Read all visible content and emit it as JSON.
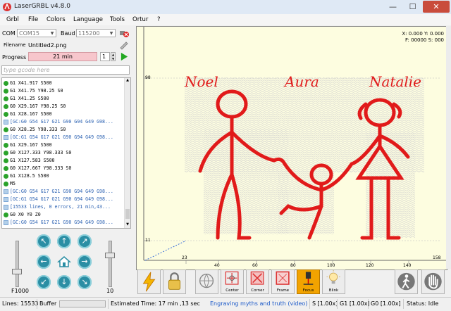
{
  "window": {
    "title": "LaserGRBL v4.8.0",
    "minimize": "—",
    "maximize": "☐",
    "close": "✕"
  },
  "menu": [
    "Grbl",
    "File",
    "Colors",
    "Language",
    "Tools",
    "Ortur",
    "?"
  ],
  "connection": {
    "com_label": "COM",
    "com_value": "COM15",
    "baud_label": "Baud",
    "baud_value": "115200"
  },
  "file": {
    "label": "Filename",
    "value": "Untitled2.png"
  },
  "progress": {
    "label": "Progress",
    "value_text": "21 min",
    "copies": "1"
  },
  "command": {
    "placeholder": "type gcode here"
  },
  "console": [
    {
      "kind": "ok",
      "text": "G1 X41.917 S500"
    },
    {
      "kind": "ok",
      "text": "G1 X41.75 Y98.25 S0"
    },
    {
      "kind": "ok",
      "text": "G1 X41.25 S500"
    },
    {
      "kind": "ok",
      "text": "G0 X29.167 Y98.25 S0"
    },
    {
      "kind": "ok",
      "text": "G1 X28.167 S500"
    },
    {
      "kind": "info",
      "text": "[GC:G0 G54 G17 G21 G90 G94 G49 G98..."
    },
    {
      "kind": "ok",
      "text": "G0 X28.25 Y98.333 S0"
    },
    {
      "kind": "info",
      "text": "[GC:G1 G54 G17 G21 G90 G94 G49 G98..."
    },
    {
      "kind": "ok",
      "text": "G1 X29.167 S500"
    },
    {
      "kind": "ok",
      "text": "G0 X127.333 Y98.333 S0"
    },
    {
      "kind": "ok",
      "text": "G1 X127.583 S500"
    },
    {
      "kind": "ok",
      "text": "G0 X127.667 Y98.333 S0"
    },
    {
      "kind": "ok",
      "text": "G1 X128.5 S500"
    },
    {
      "kind": "ok",
      "text": "M5"
    },
    {
      "kind": "info",
      "text": "[GC:G0 G54 G17 G21 G90 G94 G49 G98..."
    },
    {
      "kind": "info",
      "text": "[GC:G1 G54 G17 G21 G90 G94 G49 G98..."
    },
    {
      "kind": "info",
      "text": "[15533 lines, 0 errors, 21 min,43..."
    },
    {
      "kind": "ok",
      "text": "G0 X0 Y0 Z0"
    },
    {
      "kind": "info",
      "text": "[GC:G0 G54 G17 G21 G90 G94 G49 G98..."
    }
  ],
  "jog": {
    "feed_label": "F1000",
    "step_label": "10"
  },
  "canvas": {
    "coords": {
      "x": "X: 0.000 Y: 0.000",
      "f": "F: 00000 S: 000"
    },
    "y_ticks": [
      "98",
      "11"
    ],
    "x_ticks": [
      "23",
      "40",
      "60",
      "80",
      "100",
      "120",
      "140"
    ],
    "corner_x": "158",
    "names": [
      "Noel",
      "Aura",
      "Natalie"
    ]
  },
  "toolbar": {
    "center": "Center",
    "corner": "Corner",
    "frame": "Frame",
    "focus": "Focus",
    "blink": "Blink"
  },
  "status": {
    "lines": "Lines: 15533",
    "buffer": "Buffer",
    "estimated": "Estimated Time:  17 min ,13 sec",
    "link": "Engraving myths and truth (video)",
    "s_ovr": "S [1.00x]",
    "g1_ovr": "G1 [1.00x]",
    "g0_ovr": "G0 [1.00x]",
    "state": "Status:  Idle"
  },
  "colors": {
    "stroke": "#e11a1a",
    "canvas_bg": "#fdfde0",
    "focus_active": "#f2a300",
    "link": "#1a58c8",
    "progress_bg": "#f7c6cc"
  }
}
